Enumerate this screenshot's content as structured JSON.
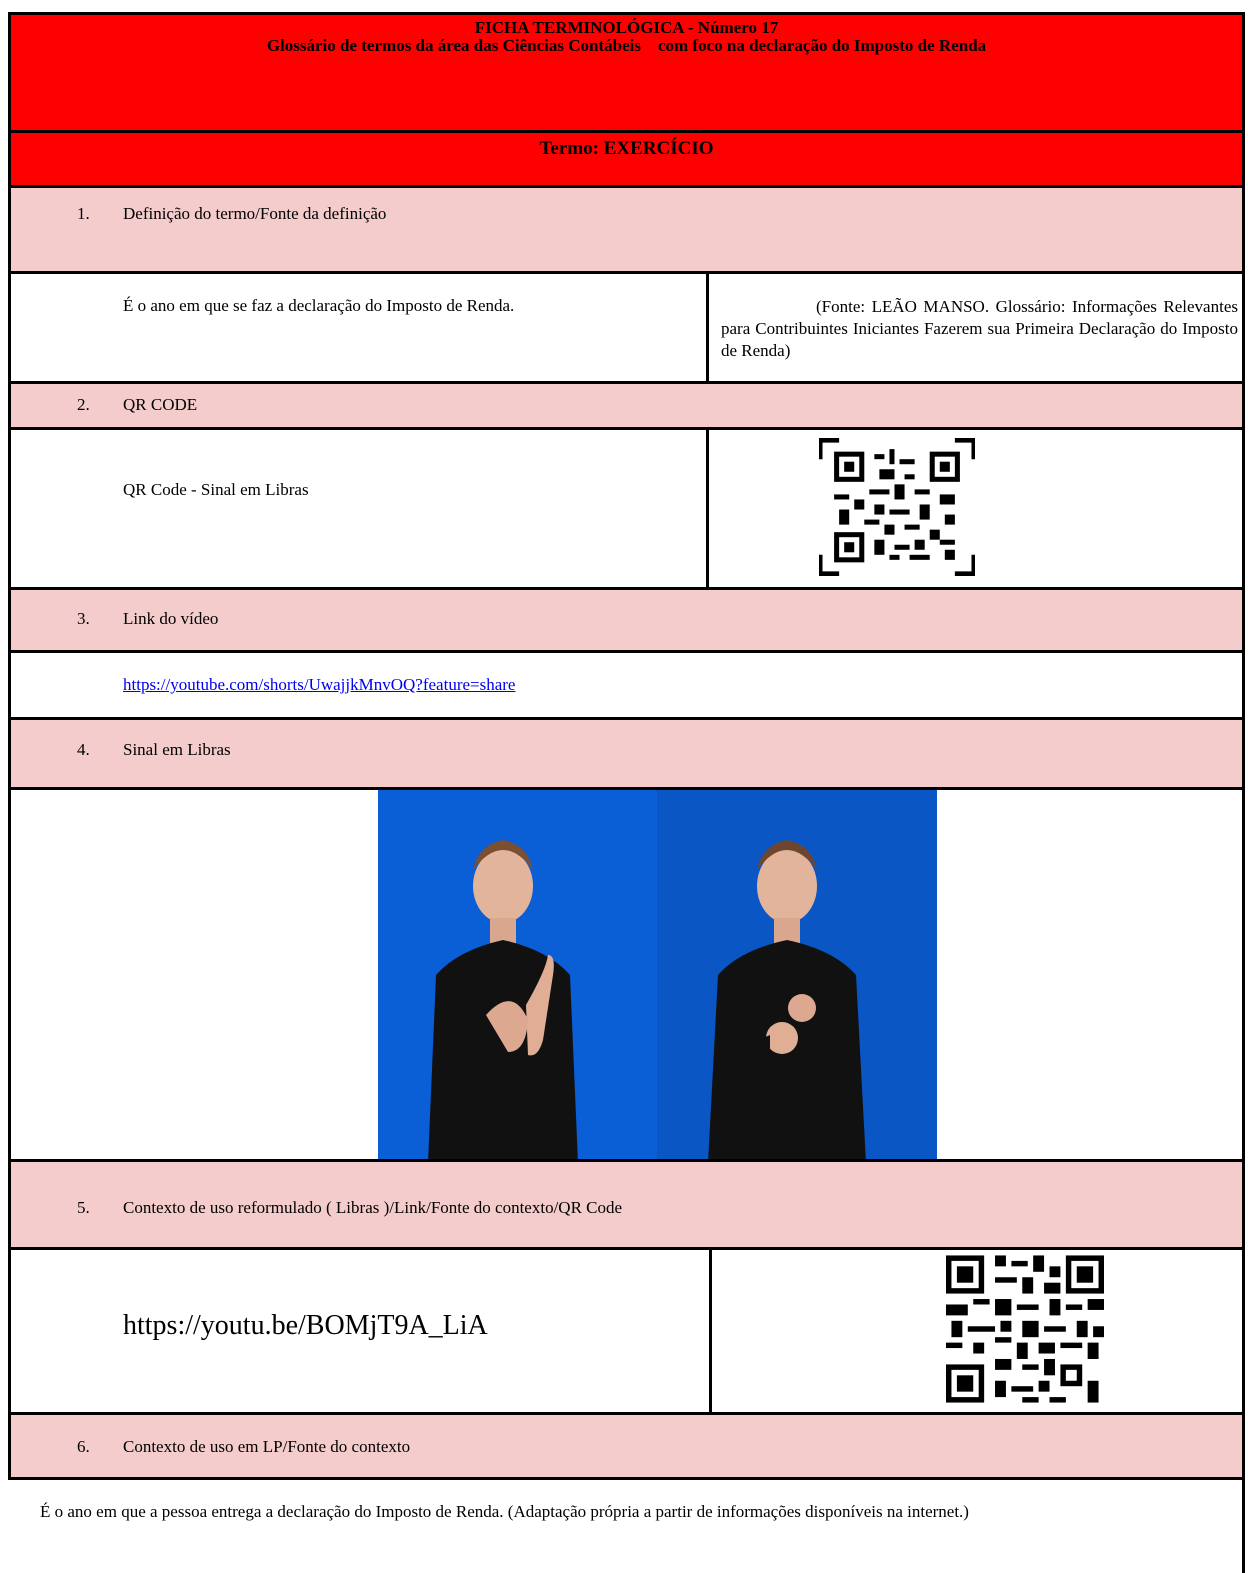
{
  "header": {
    "line1": "FICHA TERMINOLÓGICA - Número 17",
    "line2": "Glossário de termos da área das Ciências Contábeis    com foco na declaração do Imposto de Renda",
    "term": "Termo:  EXERCÍCIO"
  },
  "sections": [
    {
      "num": "1.",
      "title": "Definição do termo/Fonte da definição"
    },
    {
      "num": "2.",
      "title": "QR CODE"
    },
    {
      "num": "3.",
      "title": "Link do vídeo"
    },
    {
      "num": "4.",
      "title": "Sinal em  Libras"
    },
    {
      "num": "5.",
      "title": "Contexto de uso reformulado ( Libras )/Link/Fonte do contexto/QR Code"
    },
    {
      "num": "6.",
      "title": "Contexto de uso em LP/Fonte do contexto"
    }
  ],
  "definition": {
    "text": "É o ano em que se faz a declaração do Imposto de Renda.",
    "source": "(Fonte: LEÃO MANSO. Glossário: Informações Relevantes para Contribuintes Iniciantes Fazerem sua Primeira Declaração do Imposto de Renda)"
  },
  "qr_code": {
    "label": "QR Code - Sinal em  Libras"
  },
  "video_link": "https://youtube.com/shorts/UwajjkMnvOQ?feature=share",
  "context_libras_link": "https://youtu.be/BOMjT9A_LiA",
  "context_lp": "É o ano em que a pessoa entrega a declaração do Imposto de Renda. (Adaptação própria a partir de informações disponíveis na internet.)",
  "colors": {
    "header_red": "#ff0000",
    "section_pink": "#f4cccc",
    "photo_blue": "#0b5fd6",
    "link_blue": "#0000ee"
  }
}
